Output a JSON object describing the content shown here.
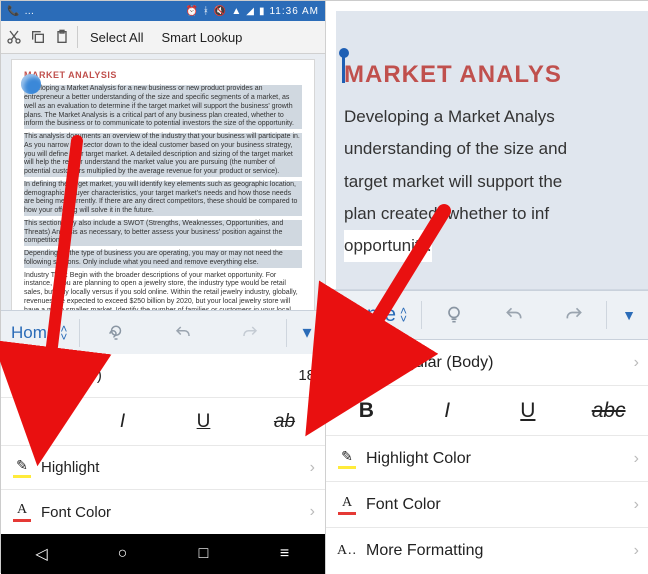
{
  "status": {
    "time": "11:36 AM"
  },
  "context_menu": {
    "select_all": "Select All",
    "smart_lookup": "Smart Lookup"
  },
  "doc": {
    "title": "MARKET ANALYSIS",
    "p1": "Developing a Market Analysis for a new business or new product provides an entrepreneur a better understanding of the size and specific segments of a market, as well as an evaluation to determine if the target market will support the business' growth plans. The Market Analysis is a critical part of any business plan created, whether to inform the business or to communicate to potential investors the size of the opportunity.",
    "p2": "This analysis documents an overview of the industry that your business will participate in. As you narrow this sector down to the ideal customer based on your business strategy, you will define your target market. A detailed description and sizing of the target market will help the reader understand the market value you are pursuing (the number of potential customers multiplied by the average revenue for your product or service).",
    "p3": "In defining the target market, you will identify key elements such as geographic location, demographics, buyer characteristics, your target market's needs and how those needs are being met currently. If there are any direct competitors, these should be compared to how your offering will solve it in the future.",
    "p4": "This section may also include a SWOT (Strengths, Weaknesses, Opportunities, and Threats) Analysis as necessary, to better assess your business' position against the competition.",
    "p5": "Depending on the type of business you are operating, you may or may not need the following sections. Only include what you need and remove everything else.",
    "p6": "Industry Type: Begin with the broader descriptions of your market opportunity. For instance, if you are planning to open a jewelry store, the industry type would be retail sales, but only locally versus if you sold online. Within the retail jewelry industry, globally, revenues are expected to exceed $250 billion by 2020, but your local jewelry store will have a much smaller market. Identify the number of families or customers in your local geography that might fit into your demographic target group."
  },
  "zoom": {
    "title": "MARKET ANALYS",
    "l1": "Developing a Market Analys",
    "l2": "understanding of the size and",
    "l3": "target market will support the",
    "l4": "plan created, whether to inf",
    "l5": "opportunity."
  },
  "ribbon": {
    "home": "Home"
  },
  "panel_left": {
    "font": "Calibri (Body)",
    "size": "18",
    "bold": "B",
    "italic": "I",
    "underline": "U",
    "strike": "ab",
    "highlight": "Highlight",
    "fontcolor": "Font Color"
  },
  "panel_right": {
    "font": "Calibri Regular (Body)",
    "bold": "B",
    "italic": "I",
    "underline": "U",
    "strike": "abc",
    "highlight": "Highlight Color",
    "fontcolor": "Font Color",
    "moreformat": "More Formatting"
  }
}
